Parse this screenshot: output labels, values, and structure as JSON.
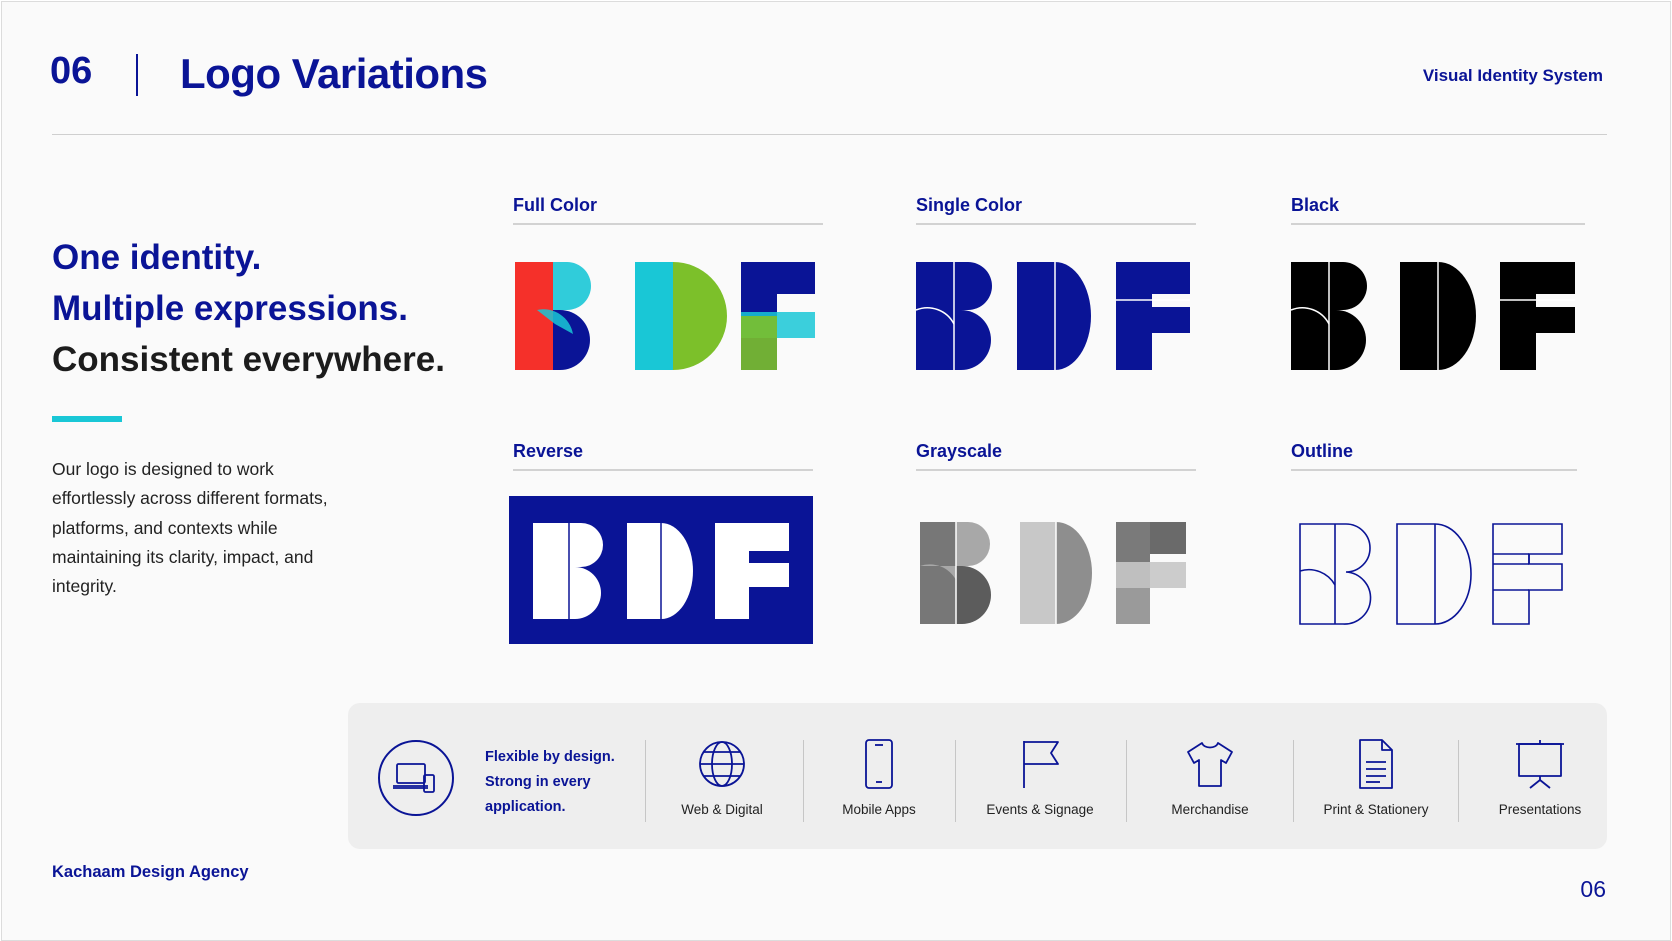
{
  "header": {
    "section_number": "06",
    "title": "Logo Variations",
    "document_label": "Visual Identity System"
  },
  "intro": {
    "headline_line1": "One identity.",
    "headline_line2": "Multiple expressions.",
    "headline_line3": "Consistent everywhere.",
    "body": "Our logo is designed to work effortlessly across different formats, platforms, and contexts while maintaining its clarity, impact, and integrity."
  },
  "variants": [
    {
      "label": "Full Color"
    },
    {
      "label": "Single Color"
    },
    {
      "label": "Black"
    },
    {
      "label": "Reverse"
    },
    {
      "label": "Grayscale"
    },
    {
      "label": "Outline"
    }
  ],
  "logo_letters": "BDF",
  "colors": {
    "navy": "#0a1496",
    "cyan": "#19c7d6",
    "red": "#f5302a",
    "green": "#7cc02a",
    "black": "#000000"
  },
  "applications": {
    "intro_icon": "devices-icon",
    "intro_text": "Flexible by design. Strong in every application.",
    "items": [
      {
        "label": "Web & Digital",
        "icon": "globe-icon"
      },
      {
        "label": "Mobile Apps",
        "icon": "mobile-icon"
      },
      {
        "label": "Events & Signage",
        "icon": "flag-icon"
      },
      {
        "label": "Merchandise",
        "icon": "tshirt-icon"
      },
      {
        "label": "Print & Stationery",
        "icon": "document-icon"
      },
      {
        "label": "Presentations",
        "icon": "presentation-icon"
      }
    ]
  },
  "footer": {
    "brand": "Kachaam Design Agency",
    "page_number": "06"
  }
}
